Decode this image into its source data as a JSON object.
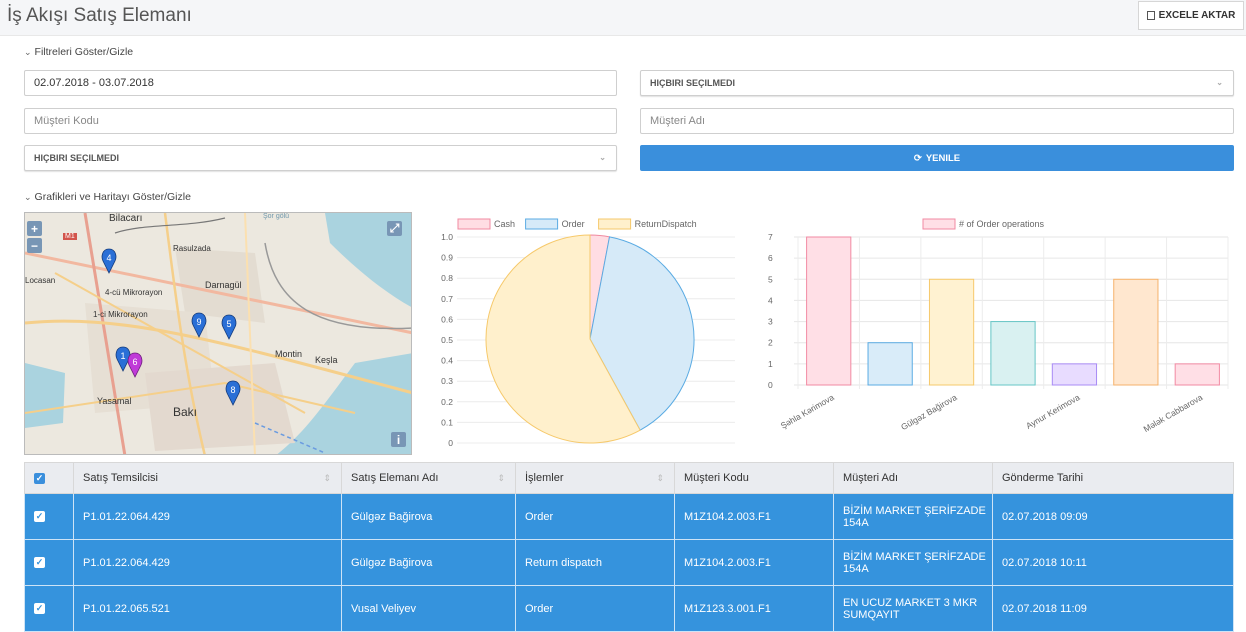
{
  "header": {
    "title": "İş Akışı Satış Elemanı",
    "export_label": "EXCELE AKTAR"
  },
  "filters": {
    "toggle_label": "Filtreleri Göster/Gizle",
    "date_range": "02.07.2018 - 03.07.2018",
    "select_right": "HIÇBIRI SEÇILMEDI",
    "customer_code_placeholder": "Müşteri Kodu",
    "customer_name_placeholder": "Müşteri Adı",
    "select_left": "HIÇBIRI SEÇILMEDI",
    "refresh_label": "YENILE"
  },
  "charts_toggle_label": "Grafikleri ve Haritayı Göster/Gizle",
  "map": {
    "labels": [
      "Bilacarı",
      "Rasulzada",
      "Locasan",
      "Darnagül",
      "4-cü Mikrorayon",
      "1-ci Mikrorayon",
      "Montin",
      "Keşla",
      "Yasamal",
      "Bakı",
      "M1",
      "Şor gölü"
    ],
    "markers": [
      "4",
      "9",
      "5",
      "1",
      "6",
      "8"
    ],
    "marker_color": "#2a6fd6",
    "marker_alt_color": "#c03ad8",
    "zoom_in": "+",
    "zoom_out": "−",
    "fullscreen": "⤢",
    "info": "i"
  },
  "chart_data": [
    {
      "type": "pie",
      "legend": [
        "Cash",
        "Order",
        "ReturnDispatch"
      ],
      "values": [
        0.03,
        0.39,
        0.58
      ],
      "y_ticks": [
        "1.0",
        "0.9",
        "0.8",
        "0.7",
        "0.6",
        "0.5",
        "0.4",
        "0.3",
        "0.2",
        "0.1",
        "0"
      ],
      "legend_position": "top",
      "colors": [
        "#ffdde3",
        "#d6eaf8",
        "#fff0cc"
      ],
      "border_colors": [
        "#f08aa0",
        "#5aabe3",
        "#f6c96b"
      ]
    },
    {
      "type": "bar",
      "legend": [
        "# of Order operations"
      ],
      "categories": [
        "Şəhla Kərimova",
        "",
        "Gülgəz Bağirova",
        "",
        "Aynur Kerimova",
        "",
        "Mələk Cabbarova"
      ],
      "tick_labels": [
        "Şəhla Kərimova",
        "Gülgəz Bağirova",
        "Aynur Kerimova",
        "Mələk Cabbarova"
      ],
      "values": [
        7,
        2,
        5,
        3,
        1,
        5,
        1
      ],
      "ylim": [
        0,
        7
      ],
      "y_ticks": [
        "7",
        "6",
        "5",
        "4",
        "3",
        "2",
        "1",
        "0"
      ],
      "grid": true,
      "legend_position": "top",
      "fill_colors": [
        "#ffdfe6",
        "#d9ecf9",
        "#fff2d1",
        "#d9f1f1",
        "#e8dcff",
        "#ffe7cf",
        "#ffdfe6"
      ],
      "border_colors": [
        "#f28aa3",
        "#5aabe3",
        "#f6c96b",
        "#66c6c6",
        "#a88bf5",
        "#f6b26b",
        "#f28aa3"
      ]
    }
  ],
  "table": {
    "columns": [
      "Satış Temsilcisi",
      "Satış Elemanı Adı",
      "İşlemler",
      "Müşteri Kodu",
      "Müşteri Adı",
      "Gönderme Tarihi"
    ],
    "rows": [
      [
        "P1.01.22.064.429",
        "Gülgəz Bağirova",
        "Order",
        "M1Z104.2.003.F1",
        "BİZİM MARKET ŞERİFZADE 154A",
        "02.07.2018 09:09"
      ],
      [
        "P1.01.22.064.429",
        "Gülgəz Bağirova",
        "Return dispatch",
        "M1Z104.2.003.F1",
        "BİZİM MARKET ŞERİFZADE 154A",
        "02.07.2018 10:11"
      ],
      [
        "P1.01.22.065.521",
        "Vusal Veliyev",
        "Order",
        "M1Z123.3.001.F1",
        "EN UCUZ MARKET 3 MKR SUMQAYIT",
        "02.07.2018 11:09"
      ]
    ]
  },
  "colors": {
    "accent": "#3a8fdc",
    "row_selected": "#3593dd"
  }
}
